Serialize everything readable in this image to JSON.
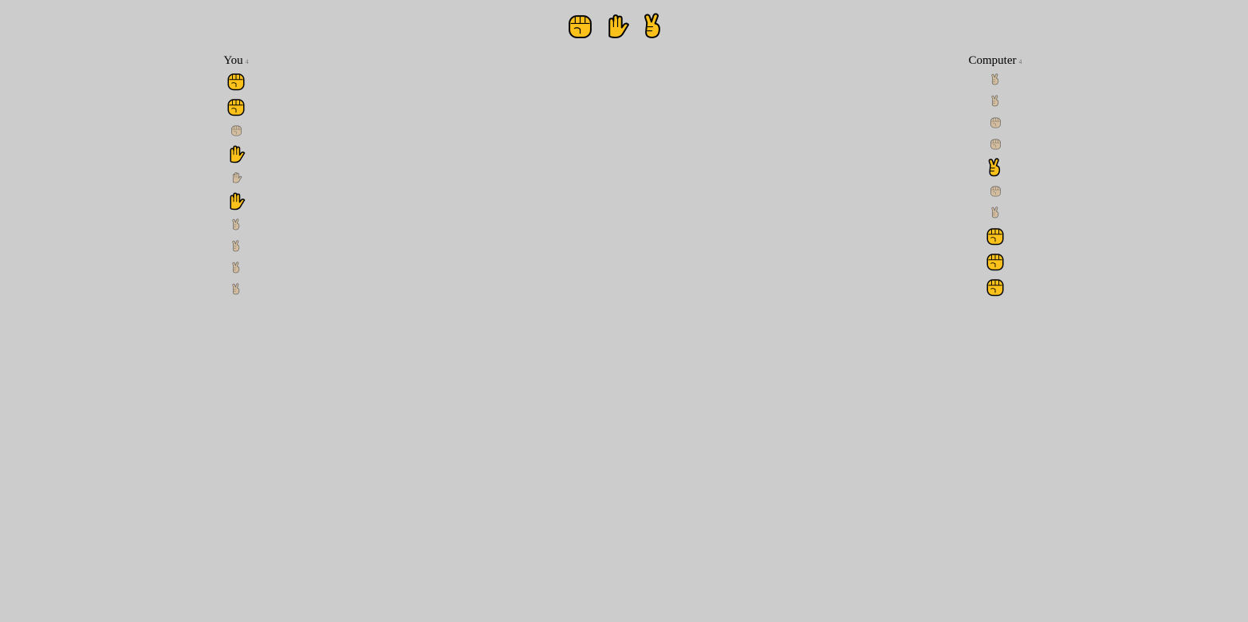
{
  "choices": [
    {
      "move": "rock",
      "icon": "fist-icon"
    },
    {
      "move": "paper",
      "icon": "raised-hand-icon"
    },
    {
      "move": "scissors",
      "icon": "victory-hand-icon"
    }
  ],
  "players": {
    "you": {
      "label": "You",
      "score": "4"
    },
    "computer": {
      "label": "Computer",
      "score": "4"
    }
  },
  "history": {
    "you": [
      {
        "move": "rock",
        "won": true
      },
      {
        "move": "rock",
        "won": true
      },
      {
        "move": "rock",
        "won": false
      },
      {
        "move": "paper",
        "won": true
      },
      {
        "move": "paper",
        "won": false
      },
      {
        "move": "paper",
        "won": true
      },
      {
        "move": "scissors",
        "won": false
      },
      {
        "move": "scissors",
        "won": false
      },
      {
        "move": "scissors",
        "won": false
      },
      {
        "move": "scissors",
        "won": false
      }
    ],
    "computer": [
      {
        "move": "scissors",
        "won": false
      },
      {
        "move": "scissors",
        "won": false
      },
      {
        "move": "rock",
        "won": false
      },
      {
        "move": "rock",
        "won": false
      },
      {
        "move": "scissors",
        "won": true
      },
      {
        "move": "rock",
        "won": false
      },
      {
        "move": "scissors",
        "won": false
      },
      {
        "move": "rock",
        "won": true
      },
      {
        "move": "rock",
        "won": true
      },
      {
        "move": "rock",
        "won": true
      }
    ]
  },
  "colors": {
    "background": "#cccccc",
    "emoji_fill": "#fcc21b",
    "outline": "#000000",
    "faded_fill": "#d9b27a"
  }
}
